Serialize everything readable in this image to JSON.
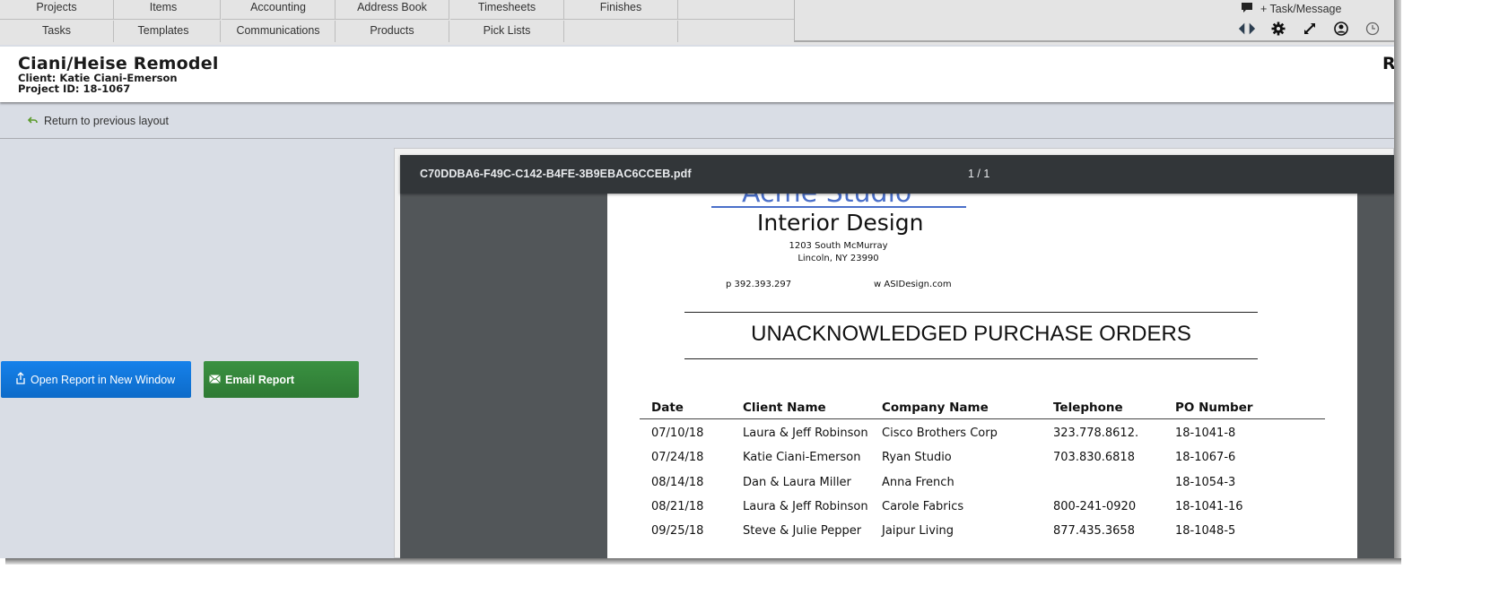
{
  "nav": {
    "row1": [
      "Projects",
      "Items",
      "Accounting",
      "Address Book",
      "Timesheets",
      "Finishes",
      ""
    ],
    "row2": [
      "Tasks",
      "Templates",
      "Communications",
      "Products",
      "Pick Lists",
      "",
      ""
    ],
    "task_message_label": "+ Task/Message",
    "icons": [
      "prev-next-arrows-icon",
      "gear-icon",
      "expand-icon",
      "user-icon",
      "clock-icon"
    ]
  },
  "project": {
    "title": "Ciani/Heise Remodel",
    "client": "Client: Katie Ciani-Emerson",
    "project_id": "Project ID: 18-1067",
    "right_truncated": "R"
  },
  "return_link": "Return to previous layout",
  "buttons": {
    "open_report": "Open Report in New Window",
    "email_report": "Email Report"
  },
  "colors": {
    "open_button": "#1178e0",
    "email_button": "#348539",
    "return_icon": "#5a9a2a",
    "pdf_toolbar": "#323639",
    "logo_blue": "#4a6fc9"
  },
  "pdf": {
    "filename": "C70DDBA6-F49C-C142-B4FE-3B9EBAC6CCEB.pdf",
    "page_indicator": "1 / 1",
    "document": {
      "company_logo_partial": "Acme Studio",
      "company_line": "Interior Design",
      "address_line1": "1203 South McMurray",
      "address_line2": "Lincoln, NY 23990",
      "phone": "p 392.393.297",
      "website": "w ASIDesign.com",
      "report_title": "UNACKNOWLEDGED PURCHASE ORDERS",
      "table": {
        "headers": [
          "Date",
          "Client Name",
          "Company Name",
          "Telephone",
          "PO Number"
        ],
        "rows": [
          [
            "07/10/18",
            "Laura & Jeff Robinson",
            "Cisco Brothers Corp",
            "323.778.8612.",
            "18-1041-8"
          ],
          [
            "07/24/18",
            "Katie Ciani-Emerson",
            "Ryan Studio",
            "703.830.6818",
            "18-1067-6"
          ],
          [
            "08/14/18",
            "Dan & Laura Miller",
            "Anna French",
            "",
            "18-1054-3"
          ],
          [
            "08/21/18",
            "Laura & Jeff Robinson",
            "Carole Fabrics",
            "800-241-0920",
            "18-1041-16"
          ],
          [
            "09/25/18",
            "Steve & Julie Pepper",
            "Jaipur Living",
            "877.435.3658",
            "18-1048-5"
          ]
        ]
      }
    }
  }
}
